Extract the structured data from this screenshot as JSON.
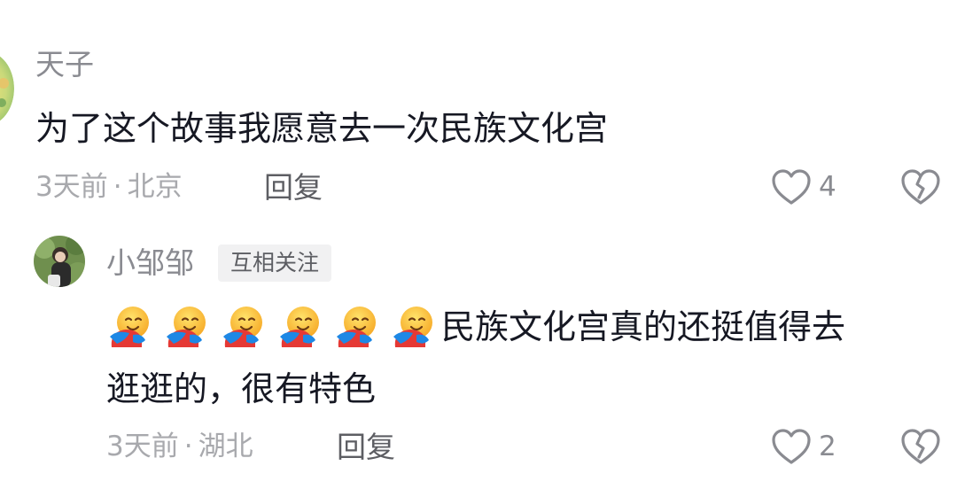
{
  "comments": [
    {
      "username": "天子",
      "text": "为了这个故事我愿意去一次民族文化宫",
      "time": "3天前",
      "location": "北京",
      "reply_label": "回复",
      "like_count": "4"
    },
    {
      "username": "小邹邹",
      "tag": "互相关注",
      "emoji_name": "hugging-face-emoji",
      "text_line1": "民族文化宫真的还挺值得去",
      "text_line2": "逛逛的，很有特色",
      "time": "3天前",
      "location": "湖北",
      "reply_label": "回复",
      "like_count": "2"
    }
  ],
  "meta_separator": "·",
  "colors": {
    "primary_text": "#161823",
    "secondary_text": "#8a8b91",
    "meta_text": "#a8a9ad",
    "tag_bg": "#f1f1f2"
  },
  "icons": [
    "heart-outline-icon",
    "broken-heart-icon",
    "hugging-face-emoji"
  ]
}
